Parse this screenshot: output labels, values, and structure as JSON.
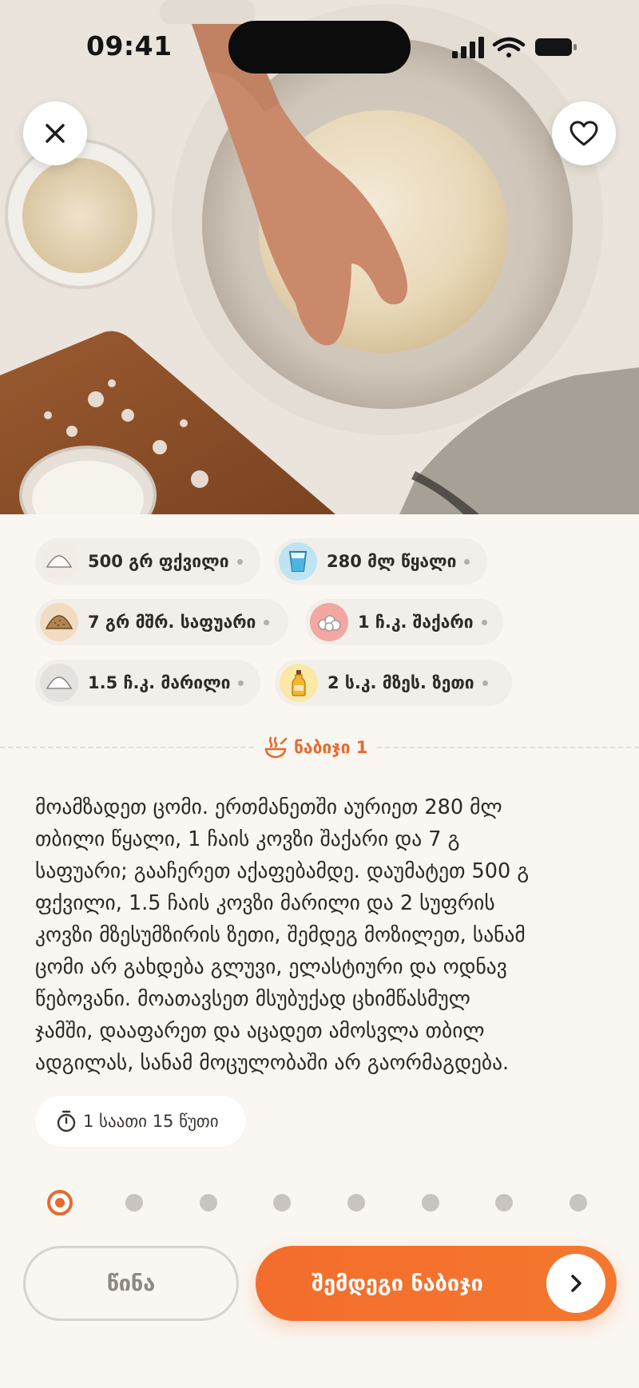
{
  "status_bar": {
    "time": "09:41"
  },
  "header": {
    "close_icon": "close-icon",
    "favorite_icon": "heart-icon"
  },
  "ingredients": [
    {
      "label": "500 გრ ფქვილი",
      "icon": "flour-pile-icon",
      "icon_bg": "#f1ede6"
    },
    {
      "label": "280 მლ წყალი",
      "icon": "water-glass-icon",
      "icon_bg": "#bfe3f2"
    },
    {
      "label": "7 გრ მშრ. საფუარი",
      "icon": "yeast-pile-icon",
      "icon_bg": "#f1dcc3"
    },
    {
      "label": "1 ჩ.კ. შაქარი",
      "icon": "sugar-cubes-icon",
      "icon_bg": "#f2a7a2"
    },
    {
      "label": "1.5 ჩ.კ. მარილი",
      "icon": "salt-pile-icon",
      "icon_bg": "#e4e2df"
    },
    {
      "label": "2 ს.კ. მზეს. ზეთი",
      "icon": "oil-bottle-icon",
      "icon_bg": "#fbe8a6"
    }
  ],
  "step": {
    "label": "ნაბიჯი 1",
    "instruction": "მოამზადეთ ცომი. ერთმანეთში აურიეთ 280 მლ\nთბილი წყალი, 1 ჩაის კოვზი შაქარი და 7 გ\nსაფუარი; გააჩერეთ აქაფებამდე. დაუმატეთ 500 გ\nფქვილი, 1.5 ჩაის კოვზი მარილი და 2 სუფრის\nკოვზი მზესუმზირის ზეთი, შემდეგ მოზილეთ, სანამ\nცომი არ გახდება გლუვი, ელასტიური და ოდნავ\nწებოვანი. მოათავსეთ მსუბუქად ცხიმწასმულ\nჯამში, დააფარეთ და აცადეთ ამოსვლა თბილ\nადგილას, სანამ მოცულობაში არ გაორმაგდება.",
    "timer": "1 საათი 15 წუთი"
  },
  "progress": {
    "total_steps": 8,
    "current_step": 1
  },
  "nav": {
    "prev_label": "წინა",
    "next_label": "შემდეგი ნაბიჯი"
  },
  "colors": {
    "accent": "#f36d2c",
    "background": "#faf6f1"
  }
}
